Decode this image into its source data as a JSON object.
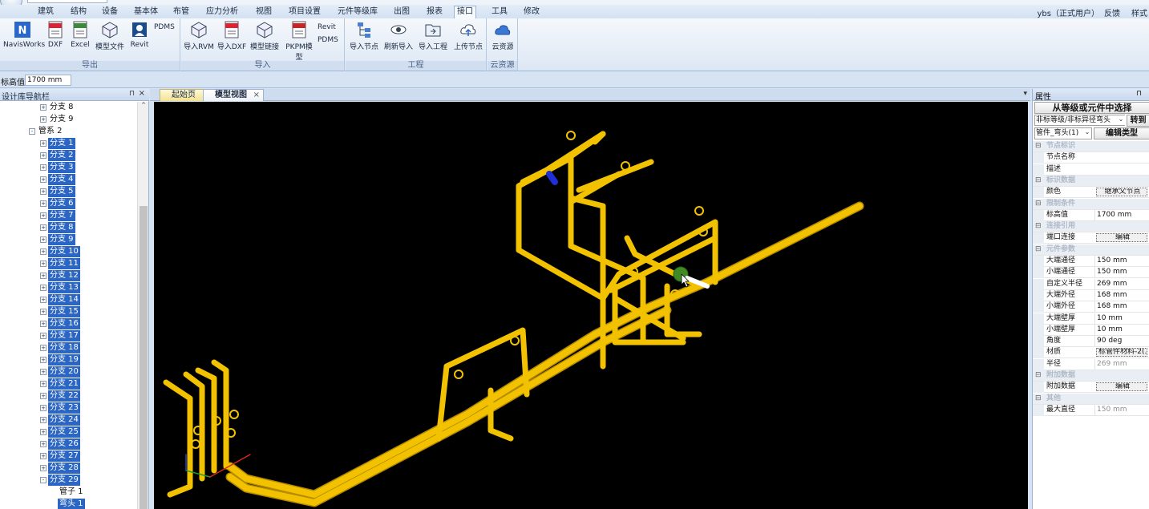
{
  "menu": {
    "tabs": [
      "建筑",
      "结构",
      "设备",
      "基本体",
      "布管",
      "应力分析",
      "视图",
      "项目设置",
      "元件等级库",
      "出图",
      "报表",
      "接口",
      "工具",
      "修改"
    ],
    "active_tab": "接口",
    "user": "ybs（正式用户）",
    "feedback": "反馈",
    "style": "样式"
  },
  "ribbon": {
    "export": {
      "label": "导出",
      "buttons": [
        "NavisWorks",
        "DXF",
        "Excel",
        "模型文件",
        "Revit"
      ],
      "side": "PDMS"
    },
    "import": {
      "label": "导入",
      "buttons": [
        "导入RVM",
        "导入DXF",
        "模型链接",
        "PKPM模型"
      ],
      "side_top": "Revit",
      "side_bottom": "PDMS"
    },
    "project": {
      "label": "工程",
      "buttons": [
        "导入节点",
        "刷新导入",
        "导入工程",
        "上传节点"
      ]
    },
    "cloud": {
      "label": "云资源",
      "buttons": [
        "云资源"
      ]
    }
  },
  "elevation": {
    "label": "标高值",
    "value": "1700 mm"
  },
  "navigator": {
    "title": "设计库导航栏",
    "rows": [
      {
        "text": "分支 8",
        "level": 2,
        "selected": false,
        "exp": "+"
      },
      {
        "text": "分支 9",
        "level": 2,
        "selected": false,
        "exp": "+"
      },
      {
        "text": "管系 2",
        "level": 1,
        "selected": false,
        "exp": "-"
      },
      {
        "text": "分支 1",
        "level": 2,
        "selected": true,
        "exp": "+"
      },
      {
        "text": "分支 2",
        "level": 2,
        "selected": true,
        "exp": "+"
      },
      {
        "text": "分支 3",
        "level": 2,
        "selected": true,
        "exp": "+"
      },
      {
        "text": "分支 4",
        "level": 2,
        "selected": true,
        "exp": "+"
      },
      {
        "text": "分支 5",
        "level": 2,
        "selected": true,
        "exp": "+"
      },
      {
        "text": "分支 6",
        "level": 2,
        "selected": true,
        "exp": "+"
      },
      {
        "text": "分支 7",
        "level": 2,
        "selected": true,
        "exp": "+"
      },
      {
        "text": "分支 8",
        "level": 2,
        "selected": true,
        "exp": "+"
      },
      {
        "text": "分支 9",
        "level": 2,
        "selected": true,
        "exp": "+"
      },
      {
        "text": "分支 10",
        "level": 2,
        "selected": true,
        "exp": "+"
      },
      {
        "text": "分支 11",
        "level": 2,
        "selected": true,
        "exp": "+"
      },
      {
        "text": "分支 12",
        "level": 2,
        "selected": true,
        "exp": "+"
      },
      {
        "text": "分支 13",
        "level": 2,
        "selected": true,
        "exp": "+"
      },
      {
        "text": "分支 14",
        "level": 2,
        "selected": true,
        "exp": "+"
      },
      {
        "text": "分支 15",
        "level": 2,
        "selected": true,
        "exp": "+"
      },
      {
        "text": "分支 16",
        "level": 2,
        "selected": true,
        "exp": "+"
      },
      {
        "text": "分支 17",
        "level": 2,
        "selected": true,
        "exp": "+"
      },
      {
        "text": "分支 18",
        "level": 2,
        "selected": true,
        "exp": "+"
      },
      {
        "text": "分支 19",
        "level": 2,
        "selected": true,
        "exp": "+"
      },
      {
        "text": "分支 20",
        "level": 2,
        "selected": true,
        "exp": "+"
      },
      {
        "text": "分支 21",
        "level": 2,
        "selected": true,
        "exp": "+"
      },
      {
        "text": "分支 22",
        "level": 2,
        "selected": true,
        "exp": "+"
      },
      {
        "text": "分支 23",
        "level": 2,
        "selected": true,
        "exp": "+"
      },
      {
        "text": "分支 24",
        "level": 2,
        "selected": true,
        "exp": "+"
      },
      {
        "text": "分支 25",
        "level": 2,
        "selected": true,
        "exp": "+"
      },
      {
        "text": "分支 26",
        "level": 2,
        "selected": true,
        "exp": "+"
      },
      {
        "text": "分支 27",
        "level": 2,
        "selected": true,
        "exp": "+"
      },
      {
        "text": "分支 28",
        "level": 2,
        "selected": true,
        "exp": "+"
      },
      {
        "text": "分支 29",
        "level": 2,
        "selected": true,
        "exp": "-"
      },
      {
        "text": "管子 1",
        "level": 3,
        "selected": false,
        "exp": ""
      },
      {
        "text": "弯头 1",
        "level": 3,
        "selected": true,
        "exp": ""
      }
    ]
  },
  "doc_tabs": {
    "start": "起始页",
    "model": "模型视图",
    "close": "×"
  },
  "properties": {
    "title": "属性",
    "select_button": "从等级或元件中选择",
    "filter": "非标等级/非标异径弯头",
    "goto": "转到",
    "type": "管件_弯头(1)",
    "edit_type": "编辑类型",
    "grid": [
      {
        "cat": "节点标识"
      },
      {
        "name": "节点名称",
        "value": ""
      },
      {
        "name": "描述",
        "value": ""
      },
      {
        "cat": "标识数据"
      },
      {
        "name": "颜色",
        "value": "继承父节点",
        "btn": true
      },
      {
        "cat": "限制条件"
      },
      {
        "name": "标高值",
        "value": "1700 mm"
      },
      {
        "cat": "连接引用"
      },
      {
        "name": "端口连接",
        "value": "编辑",
        "btn": true
      },
      {
        "cat": "元件参数"
      },
      {
        "name": "大端通径",
        "value": "150 mm"
      },
      {
        "name": "小端通径",
        "value": "150 mm"
      },
      {
        "name": "自定义半径",
        "value": "269 mm"
      },
      {
        "name": "大端外径",
        "value": "168 mm"
      },
      {
        "name": "小端外径",
        "value": "168 mm"
      },
      {
        "name": "大端壁厚",
        "value": "10 mm"
      },
      {
        "name": "小端壁厚",
        "value": "10 mm"
      },
      {
        "name": "角度",
        "value": "90 deg"
      },
      {
        "name": "材质",
        "value": "标管件材料-2(...",
        "btn": true
      },
      {
        "name": "半径",
        "value": "269 mm",
        "grey": true
      },
      {
        "cat": "附加数据"
      },
      {
        "name": "附加数据",
        "value": "编辑",
        "btn": true
      },
      {
        "cat": "其他"
      },
      {
        "name": "最大直径",
        "value": "150 mm",
        "grey": true
      }
    ]
  },
  "colors": {
    "pipe": "#f2c200",
    "pipe_dark": "#c79a00",
    "selection": "#2c66c4",
    "viewport_bg": "#000000"
  }
}
